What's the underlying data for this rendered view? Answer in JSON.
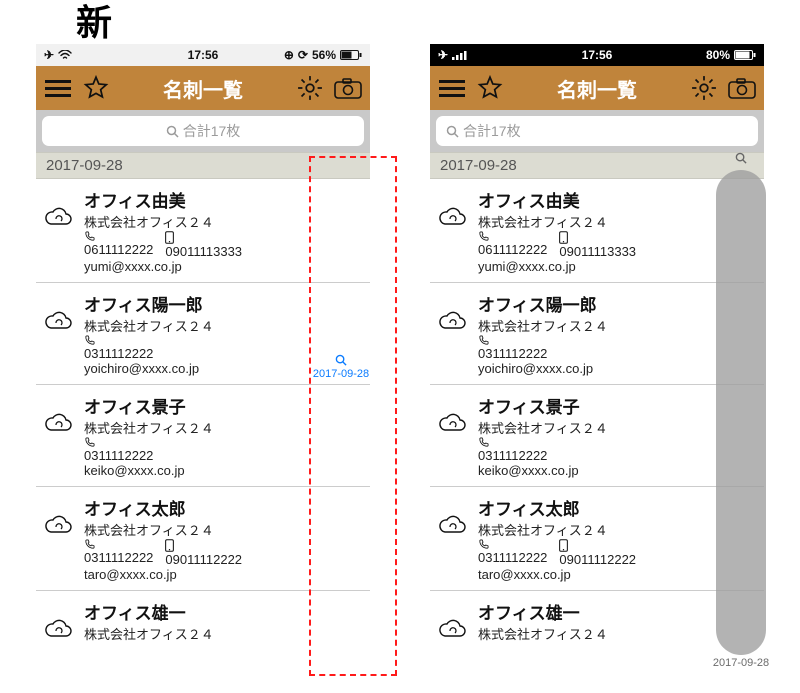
{
  "captions": {
    "left": "新",
    "right": ""
  },
  "status": {
    "time": "17:56",
    "battery_left": "56%",
    "battery_right": "80%"
  },
  "nav": {
    "title": "名刺一覧"
  },
  "search": {
    "placeholder": "合計17枚",
    "icon_glyph": "🔍"
  },
  "section_date": "2017-09-28",
  "index_label": "2017-09-28",
  "contacts": [
    {
      "name": "オフィス由美",
      "company": "株式会社オフィス２４",
      "tel": "0611112222",
      "mobile": "09011113333",
      "email": "yumi@xxxx.co.jp"
    },
    {
      "name": "オフィス陽一郎",
      "company": "株式会社オフィス２４",
      "tel": "0311112222",
      "mobile": "",
      "email": "yoichiro@xxxx.co.jp"
    },
    {
      "name": "オフィス景子",
      "company": "株式会社オフィス２４",
      "tel": "0311112222",
      "mobile": "",
      "email": "keiko@xxxx.co.jp"
    },
    {
      "name": "オフィス太郎",
      "company": "株式会社オフィス２４",
      "tel": "0311112222",
      "mobile": "09011112222",
      "email": "taro@xxxx.co.jp"
    },
    {
      "name": "オフィス雄一",
      "company": "株式会社オフィス２４",
      "tel": "",
      "mobile": "",
      "email": ""
    }
  ],
  "icons": {
    "airplane": "✈",
    "wifi": "≈",
    "signal": "▮▮▮▮",
    "alarm": "⏰",
    "rotate": "↻"
  }
}
